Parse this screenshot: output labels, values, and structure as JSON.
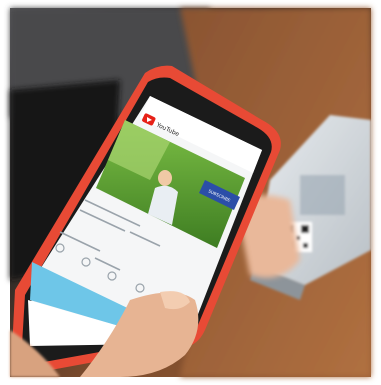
{
  "scene": {
    "description_free": true,
    "phone_screen": {
      "app_name": "YouTube",
      "subscribe_label": "SUBSCRIBE"
    },
    "icons": [
      "youtube-logo-icon",
      "search-icon",
      "account-icon",
      "qr-code-icon"
    ],
    "colors": {
      "phone_case": "#e84a35",
      "youtube_red": "#e62117",
      "screen_accent": "#6ec6e8",
      "table_wood": "#7a4a2c",
      "background_dark": "#1c1c1e"
    }
  }
}
